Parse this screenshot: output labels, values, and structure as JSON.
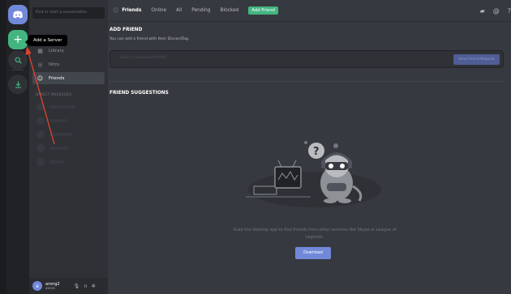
{
  "rail": {
    "tooltip": "Add a Server"
  },
  "sidebar": {
    "search_placeholder": "Find or start a conversation",
    "items": [
      {
        "label": "Library",
        "icon": "library-icon"
      },
      {
        "label": "Nitro",
        "icon": "nitro-icon"
      },
      {
        "label": "Friends",
        "icon": "friends-icon"
      }
    ],
    "dm_header": "DIRECT MESSAGES"
  },
  "user": {
    "name": "arong2",
    "tag": "#0001",
    "avatar_letter": "a"
  },
  "topbar": {
    "title": "Friends",
    "tabs": [
      "Online",
      "All",
      "Pending",
      "Blocked"
    ],
    "add_friend_label": "Add Friend"
  },
  "add_friend": {
    "title": "ADD FRIEND",
    "description": "You can add a friend with their DiscordTag.",
    "placeholder": "Enter a Username#0000",
    "send_label": "Send Friend Request"
  },
  "suggestions": {
    "title": "FRIEND SUGGESTIONS",
    "message": "Grab the desktop app to find friends from other services like Skype or League of Legends.",
    "download_label": "Download"
  },
  "colors": {
    "accent": "#7289da",
    "green": "#43b581",
    "arrow": "#e0452b"
  }
}
